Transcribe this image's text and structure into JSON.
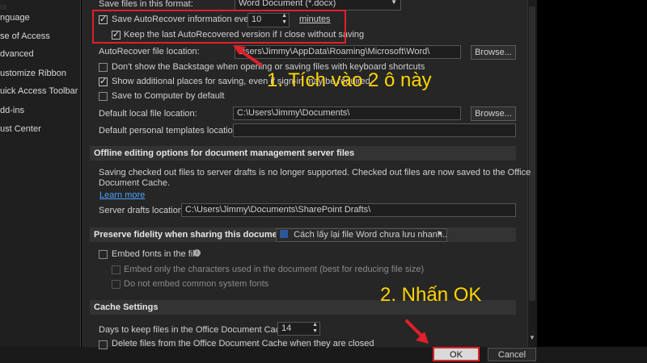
{
  "nav": {
    "items": [
      "nguage",
      "se of Access",
      "dvanced",
      "ustomize Ribbon",
      "uick Access Toolbar",
      "dd-ins",
      "ust Center"
    ]
  },
  "save": {
    "format_label": "Save files in this format:",
    "format_value": "Word Document (*.docx)",
    "autorecover_label": "Save AutoRecover information every",
    "autorecover_minutes": "10",
    "minutes_label": "minutes",
    "keep_last_label": "Keep the last AutoRecovered version if I close without saving",
    "autorecover_location_label": "AutoRecover file location:",
    "autorecover_location_value": "Users\\Jimmy\\AppData\\Roaming\\Microsoft\\Word\\",
    "browse_label": "Browse...",
    "dont_show_backstage": "Don't show the Backstage when opening or saving files with keyboard shortcuts",
    "show_additional_places": "Show additional places for saving, even if sign-in may be required.",
    "save_to_computer": "Save to Computer by default",
    "default_local_label": "Default local file location:",
    "default_local_value": "C:\\Users\\Jimmy\\Documents\\",
    "default_templates_label": "Default personal templates location:"
  },
  "offline": {
    "title": "Offline editing options for document management server files",
    "desc_line1": "Saving checked out files to server drafts is no longer supported. Checked out files are now saved to the Office",
    "desc_line2": "Document Cache.",
    "learn_more": "Learn more",
    "drafts_label": "Server drafts location:",
    "drafts_value": "C:\\Users\\Jimmy\\Documents\\SharePoint Drafts\\"
  },
  "fidelity": {
    "title": "Preserve fidelity when sharing this document:",
    "doc_value": "Cách lấy lại file Word chưa lưu nhanh...",
    "embed_fonts": "Embed fonts in the file",
    "embed_only_used": "Embed only the characters used in the document (best for reducing file size)",
    "do_not_embed_common": "Do not embed common system fonts"
  },
  "cache": {
    "title": "Cache Settings",
    "days_label": "Days to keep files in the Office Document Cache:",
    "days_value": "14",
    "delete_label": "Delete files from the Office Document Cache when they are closed"
  },
  "annotations": {
    "step1": "1. Tích vào 2 ô này",
    "step2": "2. Nhấn OK",
    "color": "#ffd400",
    "highlight_color": "#e0202a"
  },
  "footer": {
    "ok": "OK",
    "cancel": "Cancel"
  }
}
